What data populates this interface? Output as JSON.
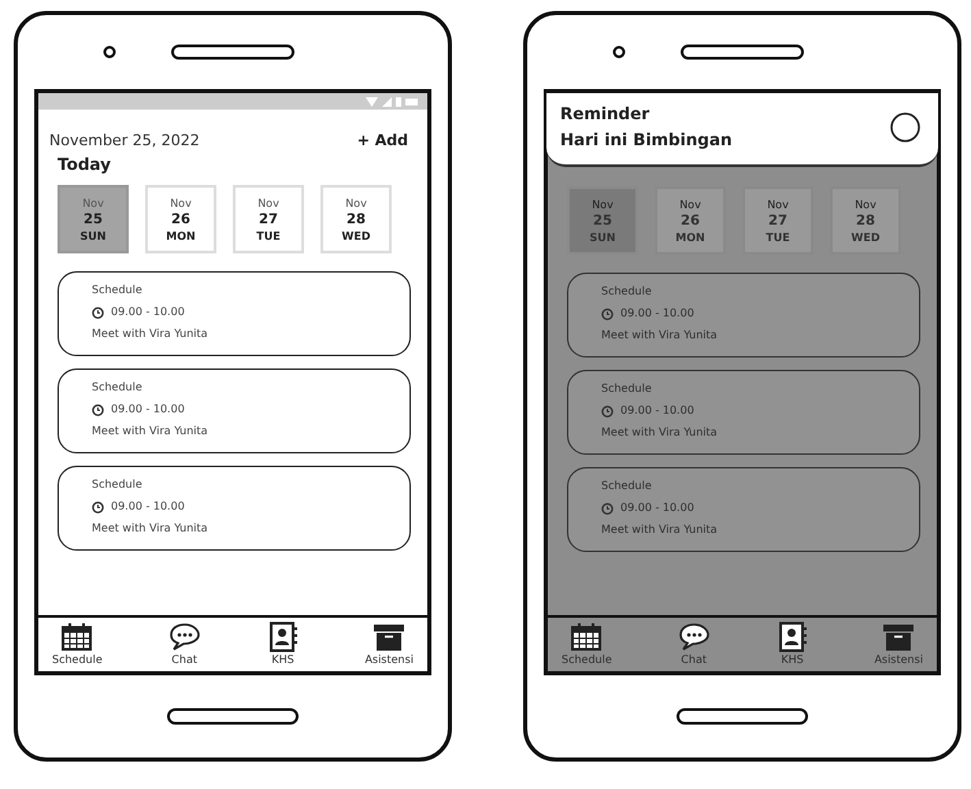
{
  "phones": [
    {
      "dimmed": false,
      "header": {
        "date": "November 25, 2022",
        "add": "+ Add",
        "title": "Today"
      },
      "days": [
        {
          "month": "Nov",
          "day": "25",
          "weekday": "SUN",
          "selected": true
        },
        {
          "month": "Nov",
          "day": "26",
          "weekday": "MON",
          "selected": false
        },
        {
          "month": "Nov",
          "day": "27",
          "weekday": "TUE",
          "selected": false
        },
        {
          "month": "Nov",
          "day": "28",
          "weekday": "WED",
          "selected": false
        }
      ],
      "schedules": [
        {
          "title": "Schedule",
          "time": "09.00 - 10.00",
          "description": "Meet with Vira Yunita"
        },
        {
          "title": "Schedule",
          "time": "09.00 - 10.00",
          "description": "Meet with Vira Yunita"
        },
        {
          "title": "Schedule",
          "time": "09.00 - 10.00",
          "description": "Meet with Vira Yunita"
        }
      ],
      "nav": [
        {
          "kind": "calendar",
          "label": "Schedule"
        },
        {
          "kind": "chat",
          "label": "Chat"
        },
        {
          "kind": "contacts",
          "label": "KHS"
        },
        {
          "kind": "archive",
          "label": "Asistensi"
        }
      ]
    },
    {
      "dimmed": true,
      "notification": {
        "title": "Reminder",
        "message": "Hari ini Bimbingan"
      },
      "days": [
        {
          "month": "Nov",
          "day": "25",
          "weekday": "SUN",
          "selected": true
        },
        {
          "month": "Nov",
          "day": "26",
          "weekday": "MON",
          "selected": false
        },
        {
          "month": "Nov",
          "day": "27",
          "weekday": "TUE",
          "selected": false
        },
        {
          "month": "Nov",
          "day": "28",
          "weekday": "WED",
          "selected": false
        }
      ],
      "schedules": [
        {
          "title": "Schedule",
          "time": "09.00 - 10.00",
          "description": "Meet with Vira Yunita"
        },
        {
          "title": "Schedule",
          "time": "09.00 - 10.00",
          "description": "Meet with Vira Yunita"
        },
        {
          "title": "Schedule",
          "time": "09.00 - 10.00",
          "description": "Meet with Vira Yunita"
        }
      ],
      "nav": [
        {
          "kind": "calendar",
          "label": "Schedule"
        },
        {
          "kind": "chat",
          "label": "Chat"
        },
        {
          "kind": "contacts",
          "label": "KHS"
        },
        {
          "kind": "archive",
          "label": "Asistensi"
        }
      ]
    }
  ]
}
